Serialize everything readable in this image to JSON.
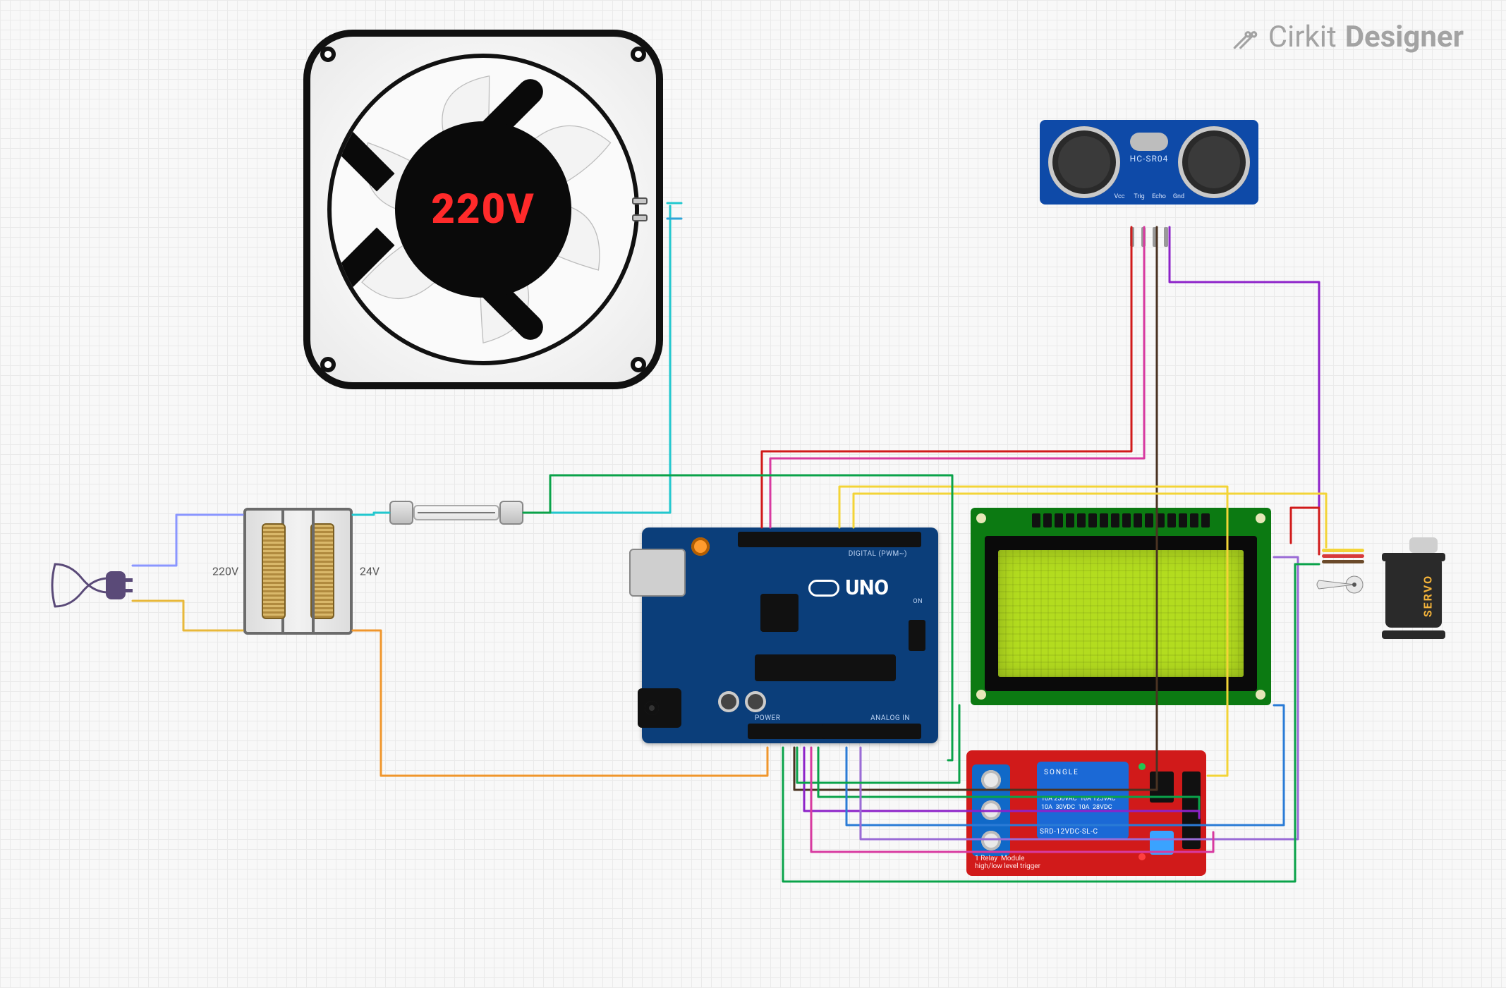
{
  "watermark": {
    "brand": "Cirkit",
    "product": "Designer"
  },
  "components": {
    "fan": {
      "voltage_label": "220V"
    },
    "transformer": {
      "primary_label": "220V",
      "secondary_label": "24V"
    },
    "ultrasonic": {
      "model": "HC-SR04",
      "pins": [
        "Vcc",
        "Trig",
        "Echo",
        "Gnd"
      ]
    },
    "arduino": {
      "logo_text": "UNO",
      "on_label": "ON",
      "header_labels": {
        "digital": "DIGITAL (PWM~)",
        "power": "POWER",
        "analog": "ANALOG IN"
      }
    },
    "lcd": {
      "pin_count": 16
    },
    "relay": {
      "brand": "SONGLE",
      "specs": "10A 250VAC  10A 125VAC\n10A  30VDC  10A  28VDC",
      "model": "SRD-12VDC-SL-C",
      "label": "1 Relay  Module\nhigh/low level trigger"
    },
    "servo": {
      "label": "SERVO"
    },
    "fuse": {},
    "plug": {}
  },
  "wires": [
    {
      "from": "plug.L",
      "to": "transformer.primary.top",
      "color": "#8a96ff"
    },
    {
      "from": "plug.N",
      "to": "transformer.primary.bottom",
      "color": "#e8b83a"
    },
    {
      "from": "transformer.sec.top",
      "to": "fuse.in",
      "color": "#22c8cf"
    },
    {
      "from": "fuse.out",
      "to": "fan.L",
      "color": "#22c8cf"
    },
    {
      "from": "transformer.sec.bottom",
      "to": "arduino.vin",
      "color": "#f0962c"
    },
    {
      "from": "arduino.gnd",
      "to": "lcd.gnd",
      "color": "#0aa34a"
    },
    {
      "from": "arduino.gnd",
      "to": "relay.gnd",
      "color": "#0aa34a"
    },
    {
      "from": "arduino.5v",
      "to": "relay.vcc",
      "color": "#8d22c9"
    },
    {
      "from": "arduino.5v",
      "to": "lcd.vcc",
      "color": "#8d22c9"
    },
    {
      "from": "arduino.d2",
      "to": "ultrasonic.trig",
      "color": "#d83aa0"
    },
    {
      "from": "arduino.d3",
      "to": "ultrasonic.echo",
      "color": "#4a3322"
    },
    {
      "from": "ultrasonic.vcc",
      "to": "arduino.5v",
      "color": "#d11a1a"
    },
    {
      "from": "ultrasonic.gnd",
      "to": "arduino.gnd",
      "color": "#8d22c9"
    },
    {
      "from": "arduino.d9",
      "to": "servo.signal",
      "color": "#f3d437"
    },
    {
      "from": "arduino.5v",
      "to": "servo.vcc",
      "color": "#d11a1a"
    },
    {
      "from": "arduino.gnd",
      "to": "servo.gnd",
      "color": "#0aa34a"
    },
    {
      "from": "arduino.d7",
      "to": "relay.in",
      "color": "#f3d437"
    },
    {
      "from": "relay.com",
      "to": "fan.N",
      "color": "#2ea5d8"
    },
    {
      "from": "arduino.a4_sda",
      "to": "lcd.sda",
      "color": "#2a7bd6"
    },
    {
      "from": "arduino.a5_scl",
      "to": "lcd.scl",
      "color": "#9a6bd6"
    }
  ]
}
